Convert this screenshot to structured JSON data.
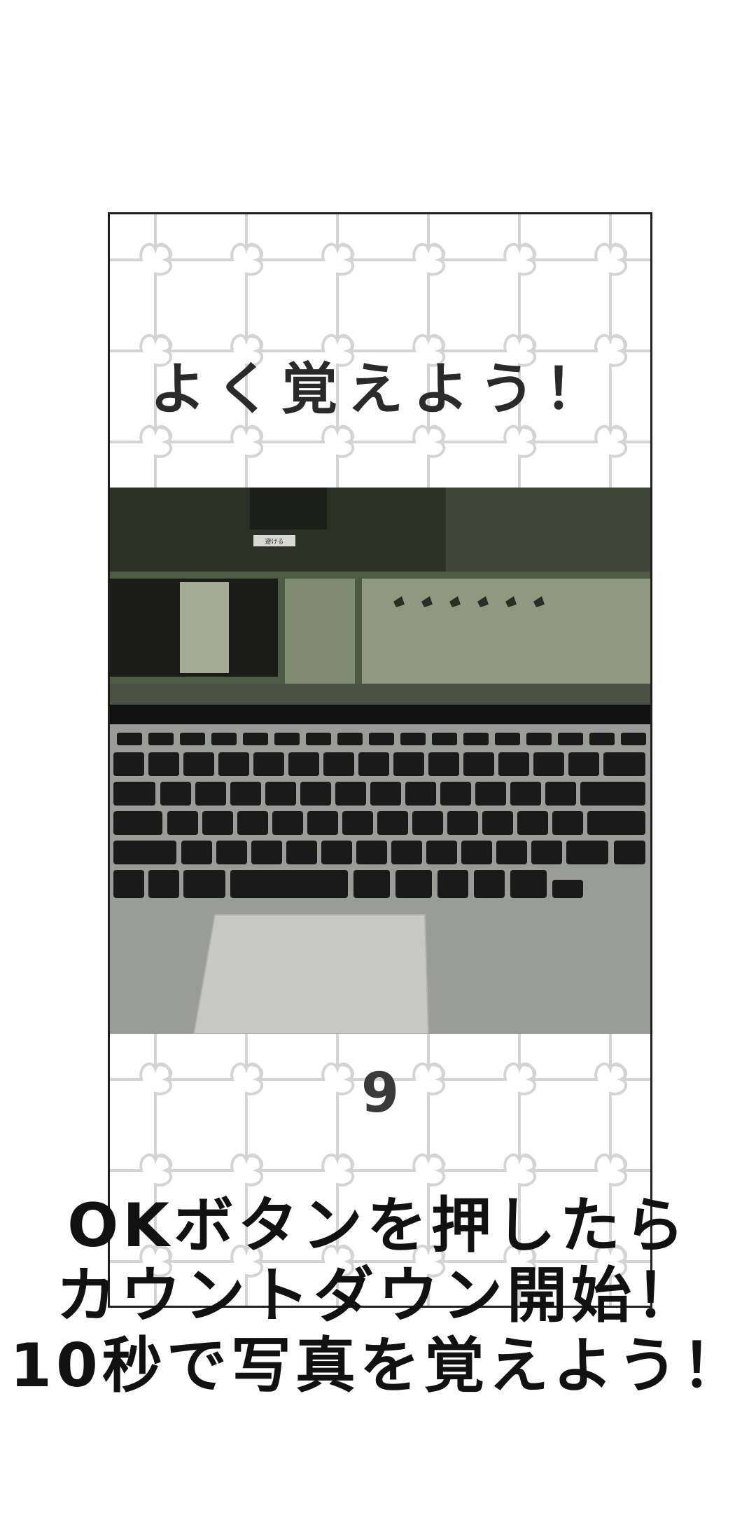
{
  "game": {
    "title": "よく覚えよう！",
    "countdown": "9",
    "photo": {
      "screen_title": "避ける"
    }
  },
  "instructions": {
    "line1": "OKボタンを押したら",
    "line2": "カウントダウン開始！",
    "line3": "10秒で写真を覚えよう！"
  },
  "colors": {
    "frame_border": "#1f1f1f",
    "puzzle_lines": "#d4d4d4",
    "text_dark": "#2a2a2a"
  }
}
